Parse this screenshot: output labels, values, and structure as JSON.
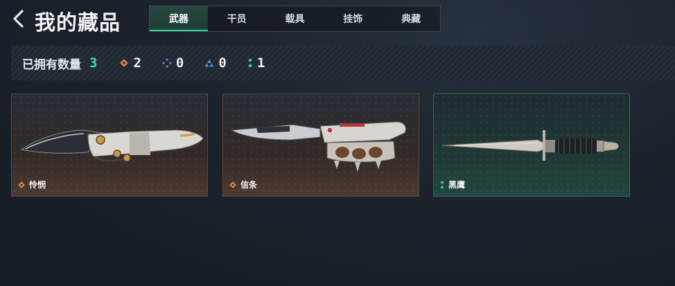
{
  "header": {
    "title": "我的藏品"
  },
  "tabs": [
    {
      "label": "武器",
      "active": true
    },
    {
      "label": "干员",
      "active": false
    },
    {
      "label": "载具",
      "active": false
    },
    {
      "label": "挂饰",
      "active": false
    },
    {
      "label": "典藏",
      "active": false
    }
  ],
  "summary": {
    "owned_label": "已拥有数量",
    "owned_total": "3",
    "rarities": [
      {
        "icon": "orange-diamond-icon",
        "color": "#e08a4a",
        "count": "2"
      },
      {
        "icon": "purple-diamond-icon",
        "color": "#8a63d6",
        "count": "0"
      },
      {
        "icon": "blue-triangle-icon",
        "color": "#4a8fd8",
        "count": "0"
      },
      {
        "icon": "green-dots-icon",
        "color": "#35d29a",
        "count": "1"
      }
    ]
  },
  "items": [
    {
      "name": "怜悯",
      "rarity_color": "#e08a4a",
      "frame": "orange"
    },
    {
      "name": "信条",
      "rarity_color": "#e08a4a",
      "frame": "orange"
    },
    {
      "name": "黑鹰",
      "rarity_color": "#35d29a",
      "frame": "green"
    }
  ]
}
